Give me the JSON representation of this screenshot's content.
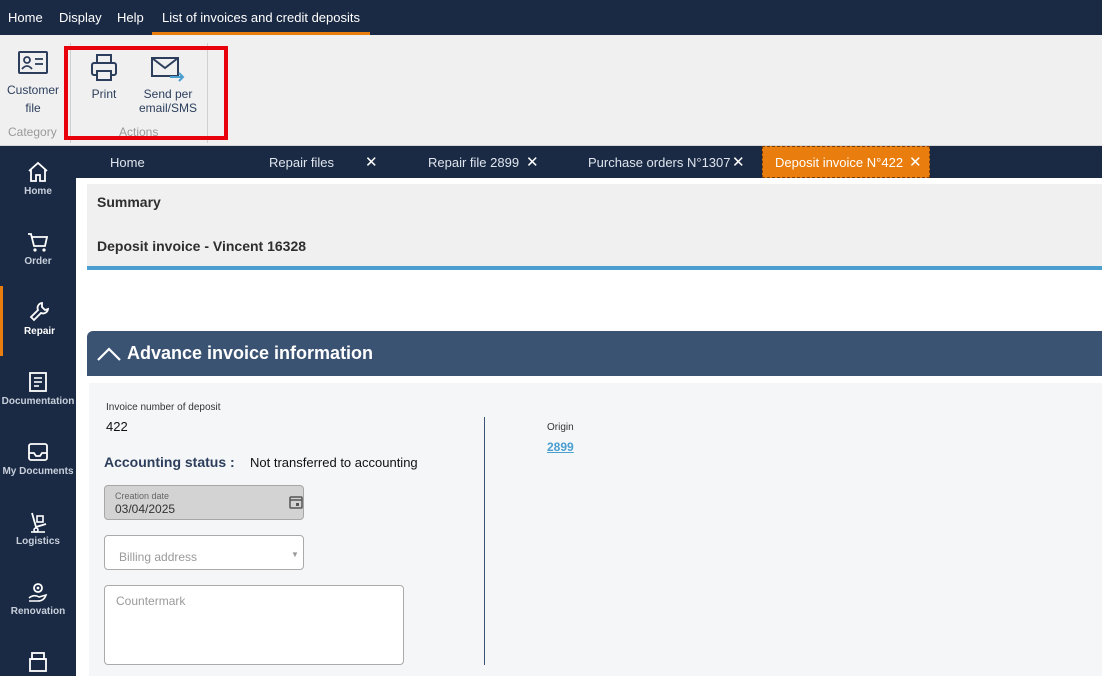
{
  "menu": {
    "home": "Home",
    "display": "Display",
    "help": "Help",
    "active": "List of invoices and credit deposits"
  },
  "ribbon": {
    "customer_file": "Customer file",
    "category_label": "Category",
    "print": "Print",
    "send_line1": "Send per",
    "send_line2": "email/SMS",
    "actions_label": "Actions"
  },
  "sidebar": {
    "items": [
      {
        "label": "Home",
        "icon": "home-icon"
      },
      {
        "label": "Order",
        "icon": "cart-icon"
      },
      {
        "label": "Repair",
        "icon": "wrench-icon"
      },
      {
        "label": "Documentation",
        "icon": "document-icon"
      },
      {
        "label": "My Documents",
        "icon": "inbox-icon"
      },
      {
        "label": "Logistics",
        "icon": "hand-truck-icon"
      },
      {
        "label": "Renovation",
        "icon": "gear-hand-icon"
      }
    ]
  },
  "tabs": [
    {
      "label": "Home"
    },
    {
      "label": "Repair files"
    },
    {
      "label": "Repair file 2899"
    },
    {
      "label": "Purchase orders N°1307"
    },
    {
      "label": "Deposit invoice N°422"
    }
  ],
  "summary": {
    "title": "Summary",
    "subtitle": "Deposit invoice - Vincent 16328"
  },
  "section": {
    "title": "Advance invoice information",
    "invoice_number_label": "Invoice number of deposit",
    "invoice_number_value": "422",
    "accounting_status_label": "Accounting status :",
    "accounting_status_value": "Not transferred to accounting",
    "creation_date_label": "Creation date",
    "creation_date_value": "03/04/2025",
    "billing_address_placeholder": "Billing address",
    "countermark_placeholder": "Countermark",
    "origin_label": "Origin",
    "origin_value": "2899"
  },
  "colors": {
    "nav_bg": "#1b2a44",
    "accent": "#e97e0e",
    "section_header": "#3b5373",
    "link": "#4a9fd0",
    "highlight": "#e8000b"
  }
}
